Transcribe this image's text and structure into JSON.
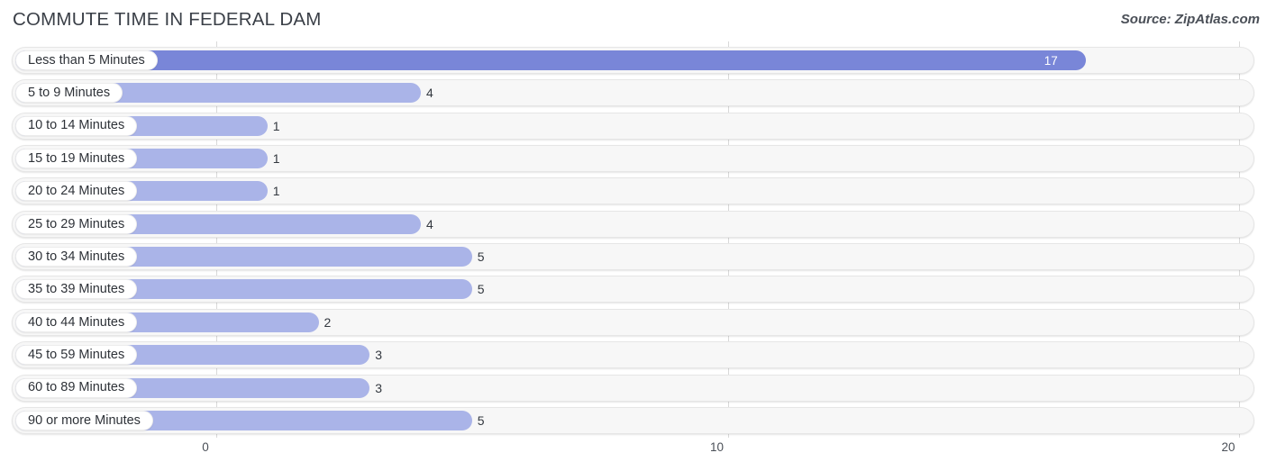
{
  "header": {
    "title": "COMMUTE TIME IN FEDERAL DAM",
    "source": "Source: ZipAtlas.com"
  },
  "colors": {
    "bar": "#aab4e8",
    "bar_highlight": "#7986d8",
    "track": "#f7f7f7",
    "gridline": "#d9d9d9",
    "text": "#2e3238"
  },
  "chart_data": {
    "type": "bar",
    "orientation": "horizontal",
    "title": "COMMUTE TIME IN FEDERAL DAM",
    "xlabel": "",
    "ylabel": "",
    "xlim": [
      0,
      20
    ],
    "grid": true,
    "legend": false,
    "xticks": [
      {
        "label": "0",
        "value": 0
      },
      {
        "label": "10",
        "value": 10
      },
      {
        "label": "20",
        "value": 20
      }
    ],
    "categories": [
      "Less than 5 Minutes",
      "5 to 9 Minutes",
      "10 to 14 Minutes",
      "15 to 19 Minutes",
      "20 to 24 Minutes",
      "25 to 29 Minutes",
      "30 to 34 Minutes",
      "35 to 39 Minutes",
      "40 to 44 Minutes",
      "45 to 59 Minutes",
      "60 to 89 Minutes",
      "90 or more Minutes"
    ],
    "values": [
      17,
      4,
      1,
      1,
      1,
      4,
      5,
      5,
      2,
      3,
      3,
      5
    ],
    "value_labels": [
      "17",
      "4",
      "1",
      "1",
      "1",
      "4",
      "5",
      "5",
      "2",
      "3",
      "3",
      "5"
    ],
    "highlight_index": 0
  }
}
